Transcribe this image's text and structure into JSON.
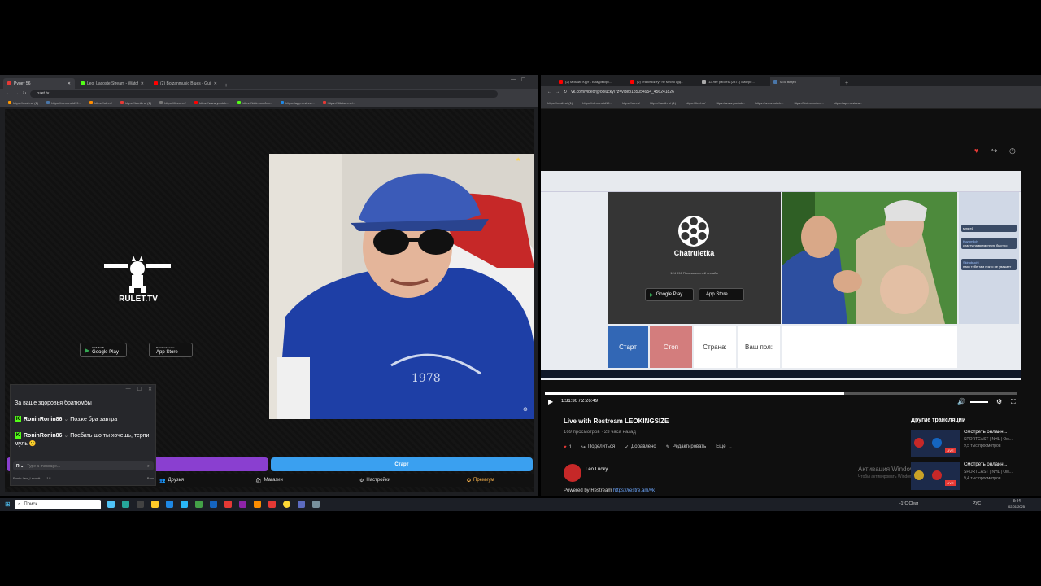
{
  "left_browser": {
    "tabs": [
      {
        "label": "Рулет 56",
        "color": "#e53935"
      },
      {
        "label": "Leo_Lacoste Stream - Watch L...",
        "color": "#53fc18"
      },
      {
        "label": "(2) Bolzanmusic Blues - Guitar",
        "color": "#ff0000"
      }
    ],
    "address": "rulet.tv",
    "bookmarks": [
      "https://mail.ru/ (1)",
      "https://vk.com/id19...",
      "https://ok.ru/",
      "https://tamli.ru/ (1)",
      "https://livecl.ru/",
      "https://www.youtub...",
      "https://kick.com/leo...",
      "https://app.restrea...",
      "https://diletso.me/..."
    ]
  },
  "rulet": {
    "brand": "RULET.TV",
    "google_play_top": "GET IT ON",
    "google_play": "Google Play",
    "app_store_top": "Download on the",
    "app_store": "App Store",
    "start_label": "Старт",
    "nav": {
      "friends": "Друзья",
      "shop": "Магазин",
      "settings": "Настройки",
      "premium": "Премиум"
    }
  },
  "chat": {
    "header": "__",
    "messages": [
      {
        "user": "",
        "text": "За ваше здоровья братюмбы"
      },
      {
        "user": "RoninRonin86",
        "text": "Позже бра завтра"
      },
      {
        "user": "RoninRonin86",
        "text": "Поебать шо ты хочешь, терпи муль 🙂"
      }
    ],
    "input_placeholder": "Type a message...",
    "footer_user": "Ronin Leo_Lacostt",
    "footer_count": "1/1",
    "footer_right": "Ваш"
  },
  "right_browser": {
    "tabs": [
      {
        "label": "(2) Михаил Круг - Владимирс...",
        "color": "#ff0000"
      },
      {
        "label": "(2) старичок тут не место куд...",
        "color": "#ff0000"
      },
      {
        "label": "12 лет работы (2371) смотре...",
        "color": "#aaaaaa"
      },
      {
        "label": "Мои видео",
        "color": "#4a76a8"
      }
    ],
    "address": "vk.com/video/@ooluckyl?z=video185054954_456241826",
    "bookmarks": [
      "https://mail.ru/ (1)",
      "https://vk.com/id19...",
      "https://ok.ru/",
      "https://tamli.ru/ (1)",
      "https://livcl.ru/",
      "https://www.youtub...",
      "https://www.twitch...",
      "https://kick.com/leo...",
      "https://app.restrea..."
    ]
  },
  "inner_video": {
    "logo": "Chatruletka",
    "online": "124 096 Пользователей онлайн",
    "google_play": "Google Play",
    "app_store": "App Store",
    "buttons": {
      "start": "Старт",
      "stop": "Стоп",
      "country": "Страна:",
      "gender": "Ваш пол:"
    },
    "side_comments": [
      {
        "user": "",
        "text": "мля ей"
      },
      {
        "user": "Kuzomilch",
        "text": "спасту на временную быстро"
      },
      {
        "user": "Skirlobuchi",
        "text": "нахи тебе там никто не уважает"
      }
    ]
  },
  "player": {
    "time_current": "1:31:30",
    "time_total": "2:26:49",
    "progress": 0.635
  },
  "video_info": {
    "title": "Live with Restream LEOKINGSIZE",
    "meta": "169 просмотров · 23 часа назад",
    "likes": "1",
    "share": "Поделиться",
    "added": "Добавлено",
    "edit": "Редактировать",
    "more": "Ещё",
    "author": "Leo Lucky",
    "powered_by": "Powered by Restream",
    "powered_link": "https://restre.am/vk",
    "activation_line1": "Активация Windows",
    "activation_line2": "Чтобы активировать Windows..."
  },
  "other_streams": {
    "heading": "Другие трансляции",
    "items": [
      {
        "title": "Смотреть онлайн...",
        "channel": "SPORTCAST | NHL | Ом...",
        "views": "9,5 тыс просмотров",
        "badge": "LIVE"
      },
      {
        "title": "Смотреть онлайн...",
        "channel": "SPORTCAST | NHL | Ом...",
        "views": "9,4 тыс просмотров",
        "badge": "LIVE"
      }
    ]
  },
  "taskbar": {
    "search": "Поиск",
    "weather": "-1°C Clear",
    "lang": "РУС",
    "time": "3:44",
    "date": "02.01.2025"
  }
}
